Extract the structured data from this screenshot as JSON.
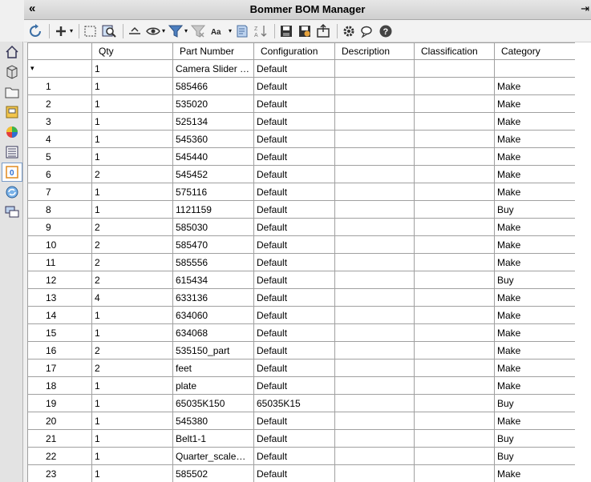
{
  "window": {
    "title": "Bommer BOM Manager"
  },
  "toolbar": {
    "icons": [
      "refresh-icon",
      "add-icon",
      "select-rectangle-icon",
      "find-icon",
      "flatten-icon",
      "visibility-icon",
      "filter-icon",
      "clear-filter-icon",
      "font-case-icon",
      "notebook-icon",
      "sort-icon",
      "save-icon",
      "save-as-icon",
      "export-icon",
      "settings-icon",
      "chat-icon",
      "help-icon"
    ]
  },
  "grid": {
    "columns": [
      "",
      "Qty",
      "Part Number",
      "Configuration",
      "Description",
      "Classification",
      "Category"
    ],
    "root": {
      "qty": "1",
      "part": "Camera Slider rev...",
      "config": "Default",
      "desc": "",
      "class": "",
      "cat": ""
    },
    "rows": [
      {
        "n": "1",
        "qty": "1",
        "part": "585466",
        "config": "Default",
        "cat": "Make"
      },
      {
        "n": "2",
        "qty": "1",
        "part": "535020",
        "config": "Default",
        "cat": "Make"
      },
      {
        "n": "3",
        "qty": "1",
        "part": "525134",
        "config": "Default",
        "cat": "Make"
      },
      {
        "n": "4",
        "qty": "1",
        "part": "545360",
        "config": "Default",
        "cat": "Make"
      },
      {
        "n": "5",
        "qty": "1",
        "part": "545440",
        "config": "Default",
        "cat": "Make"
      },
      {
        "n": "6",
        "qty": "2",
        "part": "545452",
        "config": "Default",
        "cat": "Make"
      },
      {
        "n": "7",
        "qty": "1",
        "part": "575116",
        "config": "Default",
        "cat": "Make"
      },
      {
        "n": "8",
        "qty": "1",
        "part": "1121159",
        "config": "Default",
        "cat": "Buy"
      },
      {
        "n": "9",
        "qty": "2",
        "part": "585030",
        "config": "Default",
        "cat": "Make"
      },
      {
        "n": "10",
        "qty": "2",
        "part": "585470",
        "config": "Default",
        "cat": "Make"
      },
      {
        "n": "11",
        "qty": "2",
        "part": "585556",
        "config": "Default",
        "cat": "Make"
      },
      {
        "n": "12",
        "qty": "2",
        "part": "615434",
        "config": "Default",
        "cat": "Buy"
      },
      {
        "n": "13",
        "qty": "4",
        "part": "633136",
        "config": "Default",
        "cat": "Make"
      },
      {
        "n": "14",
        "qty": "1",
        "part": "634060",
        "config": "Default",
        "cat": "Make"
      },
      {
        "n": "15",
        "qty": "1",
        "part": "634068",
        "config": "Default",
        "cat": "Make"
      },
      {
        "n": "16",
        "qty": "2",
        "part": "535150_part",
        "config": "Default",
        "cat": "Make"
      },
      {
        "n": "17",
        "qty": "2",
        "part": "feet",
        "config": "Default",
        "cat": "Make"
      },
      {
        "n": "18",
        "qty": "1",
        "part": "plate",
        "config": "Default",
        "cat": "Make"
      },
      {
        "n": "19",
        "qty": "1",
        "part": "65035K150",
        "config": "65035K15",
        "cat": "Buy"
      },
      {
        "n": "20",
        "qty": "1",
        "part": "545380",
        "config": "Default",
        "cat": "Make"
      },
      {
        "n": "21",
        "qty": "1",
        "part": "Belt1-1",
        "config": "Default",
        "cat": "Buy"
      },
      {
        "n": "22",
        "qty": "1",
        "part": "Quarter_scale_se...",
        "config": "Default",
        "cat": "Buy"
      },
      {
        "n": "23",
        "qty": "1",
        "part": "585502",
        "config": "Default",
        "cat": "Make"
      }
    ]
  },
  "colors": {
    "active_tab_border": "#7a9cc8",
    "grid_line": "#a0a0a0"
  }
}
